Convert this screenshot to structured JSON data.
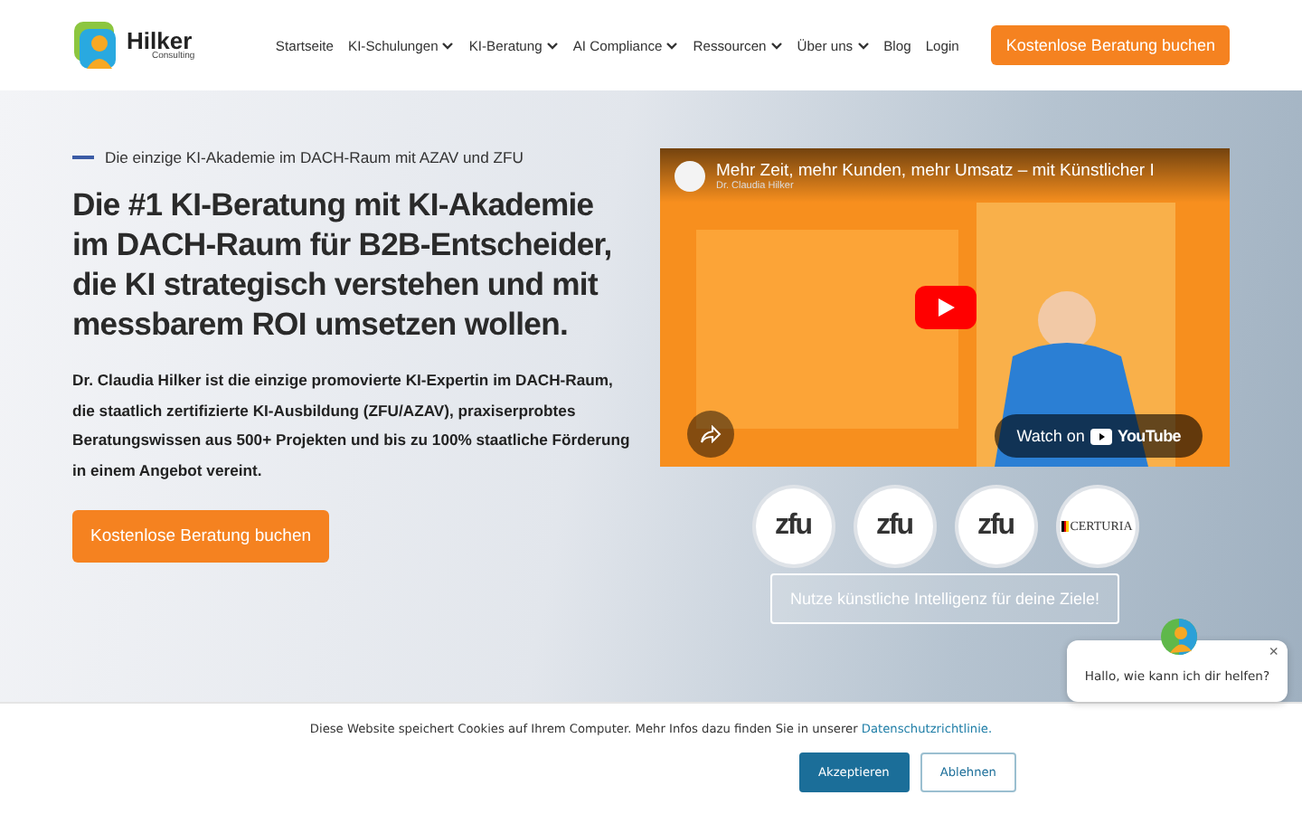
{
  "logo": {
    "name": "Hilker",
    "tagline": "Consulting"
  },
  "nav": [
    {
      "label": "Startseite",
      "dropdown": false
    },
    {
      "label": "KI-Schulungen",
      "dropdown": true
    },
    {
      "label": "KI-Beratung",
      "dropdown": true
    },
    {
      "label": "AI Compliance",
      "dropdown": true
    },
    {
      "label": "Ressourcen",
      "dropdown": true
    },
    {
      "label": "Über uns",
      "dropdown": true
    },
    {
      "label": "Blog",
      "dropdown": false
    },
    {
      "label": "Login",
      "dropdown": false
    }
  ],
  "header_cta": "Kostenlose Beratung buchen",
  "hero": {
    "eyebrow": "Die einzige KI-Akademie im DACH-Raum mit AZAV und ZFU",
    "headline": "Die #1 KI-Beratung mit KI-Akademie im DACH-Raum für B2B-Entscheider, die KI strategisch verstehen und mit messbarem ROI umsetzen wollen.",
    "intro": "Dr. Claudia Hilker ist die einzige promovierte KI-Expertin im DACH-Raum, die staatlich zertifizierte KI-Ausbildung (ZFU/AZAV), praxiserprobtes Beratungswissen aus 500+ Projekten und bis zu 100% staatliche Förderung in einem Angebot vereint.",
    "cta": "Kostenlose Beratung buchen"
  },
  "video": {
    "title": "Mehr Zeit, mehr Kunden, mehr Umsatz – mit Künstlicher I",
    "channel": "Dr. Claudia Hilker",
    "watch_on": "Watch on",
    "platform": "YouTube"
  },
  "badges": [
    {
      "kind": "zfu",
      "label": "zfu"
    },
    {
      "kind": "zfu",
      "label": "zfu"
    },
    {
      "kind": "zfu",
      "label": "zfu"
    },
    {
      "kind": "certuria",
      "label": "CERTURIA"
    }
  ],
  "secondary_cta": "Nutze künstliche Intelligenz für deine Ziele!",
  "chat": {
    "message": "Hallo, wie kann ich dir helfen?",
    "close": "×"
  },
  "cookie": {
    "text": "Diese Website speichert Cookies auf Ihrem Computer. Mehr Infos dazu finden Sie in unserer",
    "link": "Datenschutzrichtlinie.",
    "accept": "Akzeptieren",
    "decline": "Ablehnen"
  }
}
